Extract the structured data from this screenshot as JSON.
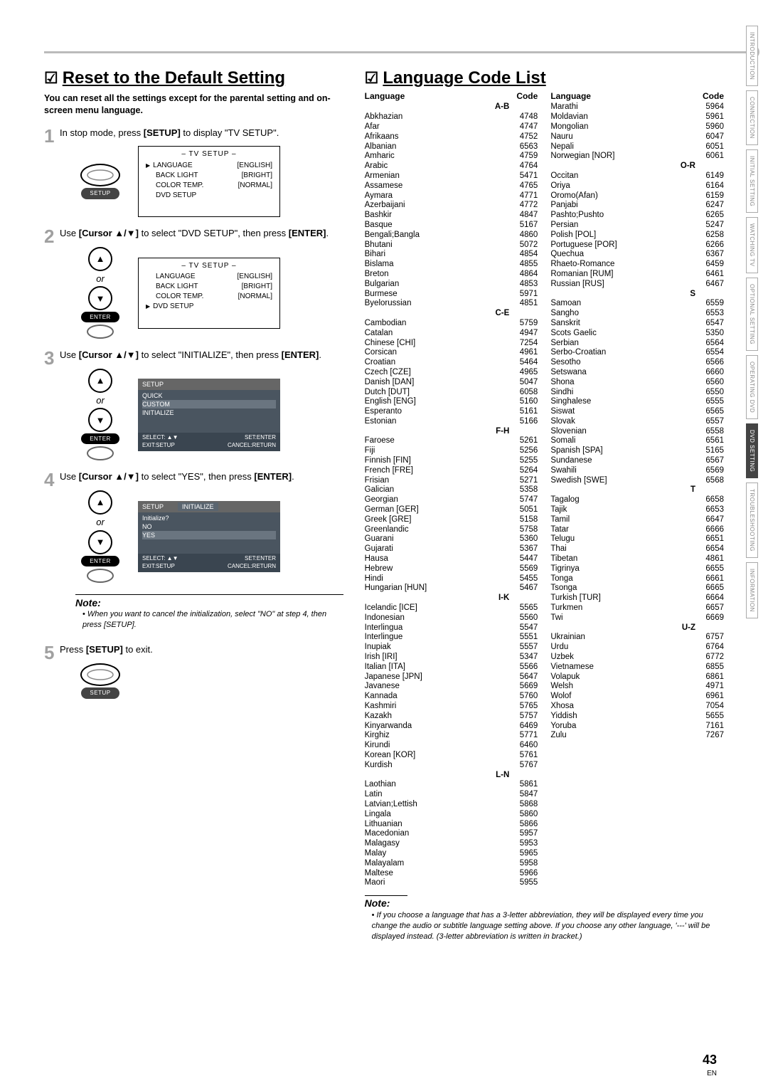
{
  "page_number": "43",
  "page_lang": "EN",
  "side_tabs": [
    "INTRODUCTION",
    "CONNECTION",
    "INITIAL SETTING",
    "WATCHING TV",
    "OPTIONAL SETTING",
    "OPERATING DVD",
    "DVD SETTING",
    "TROUBLESHOOTING",
    "INFORMATION"
  ],
  "left": {
    "title": "Reset to the Default Setting",
    "sub": "You can reset all the settings except for the parental setting and on-screen menu language.",
    "steps": [
      {
        "num": "1",
        "text_pre": "In stop mode, press ",
        "bold": "[SETUP]",
        "text_post": " to display \"TV SETUP\"."
      },
      {
        "num": "2",
        "text_pre": "Use ",
        "bold": "[Cursor ▲/▼]",
        "text_post": " to select \"DVD SETUP\", then press ",
        "bold2": "[ENTER]",
        "text_end": "."
      },
      {
        "num": "3",
        "text_pre": "Use ",
        "bold": "[Cursor ▲/▼]",
        "text_post": " to select \"INITIALIZE\", then press ",
        "bold2": "[ENTER]",
        "text_end": "."
      },
      {
        "num": "4",
        "text_pre": "Use ",
        "bold": "[Cursor ▲/▼]",
        "text_post": " to select \"YES\", then press ",
        "bold2": "[ENTER]",
        "text_end": "."
      },
      {
        "num": "5",
        "text_pre": "Press ",
        "bold": "[SETUP]",
        "text_post": " to exit."
      }
    ],
    "or": "or",
    "setup_label": "SETUP",
    "enter_label": "ENTER",
    "screen1": {
      "title": "– TV SETUP –",
      "rows": [
        [
          "LANGUAGE",
          "[ENGLISH]"
        ],
        [
          "BACK LIGHT",
          "[BRIGHT]"
        ],
        [
          "COLOR TEMP.",
          "[NORMAL]"
        ],
        [
          "DVD SETUP",
          ""
        ]
      ],
      "sel": 0
    },
    "screen2_rows": [
      [
        "LANGUAGE",
        "[ENGLISH]"
      ],
      [
        "BACK LIGHT",
        "[BRIGHT]"
      ],
      [
        "COLOR TEMP.",
        "[NORMAL]"
      ],
      [
        "DVD SETUP",
        ""
      ]
    ],
    "screen3": {
      "hd": "SETUP",
      "items": [
        "QUICK",
        "CUSTOM",
        "INITIALIZE"
      ],
      "ft_l": "SELECT: ▲▼",
      "ft_l2": "EXIT:SETUP",
      "ft_r": "SET:ENTER",
      "ft_r2": "CANCEL:RETURN"
    },
    "screen4": {
      "hd": "SETUP",
      "sub": "INITIALIZE",
      "q": "Initialize?",
      "items": [
        "NO",
        "YES"
      ]
    },
    "note_hd": "Note:",
    "note": "When you want to cancel the initialization, select \"NO\" at step 4, then press [SETUP]."
  },
  "right": {
    "title": "Language Code List",
    "col_hd_lang": "Language",
    "col_hd_code": "Code",
    "note_hd": "Note:",
    "note": "If you choose a language that has a 3-letter abbreviation, they will be displayed every time you change the audio or subtitle language setting above. If you choose any other language, '---' will be displayed instead. (3-letter abbreviation is written in bracket.)",
    "sections": {
      "A-B": [
        [
          "Abkhazian",
          "4748"
        ],
        [
          "Afar",
          "4747"
        ],
        [
          "Afrikaans",
          "4752"
        ],
        [
          "Albanian",
          "6563"
        ],
        [
          "Amharic",
          "4759"
        ],
        [
          "Arabic",
          "4764"
        ],
        [
          "Armenian",
          "5471"
        ],
        [
          "Assamese",
          "4765"
        ],
        [
          "Aymara",
          "4771"
        ],
        [
          "Azerbaijani",
          "4772"
        ],
        [
          "Bashkir",
          "4847"
        ],
        [
          "Basque",
          "5167"
        ],
        [
          "Bengali;Bangla",
          "4860"
        ],
        [
          "Bhutani",
          "5072"
        ],
        [
          "Bihari",
          "4854"
        ],
        [
          "Bislama",
          "4855"
        ],
        [
          "Breton",
          "4864"
        ],
        [
          "Bulgarian",
          "4853"
        ],
        [
          "Burmese",
          "5971"
        ],
        [
          "Byelorussian",
          "4851"
        ]
      ],
      "C-E": [
        [
          "Cambodian",
          "5759"
        ],
        [
          "Catalan",
          "4947"
        ],
        [
          "Chinese [CHI]",
          "7254"
        ],
        [
          "Corsican",
          "4961"
        ],
        [
          "Croatian",
          "5464"
        ],
        [
          "Czech [CZE]",
          "4965"
        ],
        [
          "Danish [DAN]",
          "5047"
        ],
        [
          "Dutch [DUT]",
          "6058"
        ],
        [
          "English [ENG]",
          "5160"
        ],
        [
          "Esperanto",
          "5161"
        ],
        [
          "Estonian",
          "5166"
        ]
      ],
      "F-H": [
        [
          "Faroese",
          "5261"
        ],
        [
          "Fiji",
          "5256"
        ],
        [
          "Finnish [FIN]",
          "5255"
        ],
        [
          "French [FRE]",
          "5264"
        ],
        [
          "Frisian",
          "5271"
        ],
        [
          "Galician",
          "5358"
        ],
        [
          "Georgian",
          "5747"
        ],
        [
          "German [GER]",
          "5051"
        ],
        [
          "Greek [GRE]",
          "5158"
        ],
        [
          "Greenlandic",
          "5758"
        ],
        [
          "Guarani",
          "5360"
        ],
        [
          "Gujarati",
          "5367"
        ],
        [
          "Hausa",
          "5447"
        ],
        [
          "Hebrew",
          "5569"
        ],
        [
          "Hindi",
          "5455"
        ],
        [
          "Hungarian [HUN]",
          "5467"
        ]
      ],
      "I-K": [
        [
          "Icelandic [ICE]",
          "5565"
        ],
        [
          "Indonesian",
          "5560"
        ],
        [
          "Interlingua",
          "5547"
        ],
        [
          "Interlingue",
          "5551"
        ],
        [
          "Inupiak",
          "5557"
        ],
        [
          "Irish [IRI]",
          "5347"
        ],
        [
          "Italian [ITA]",
          "5566"
        ],
        [
          "Japanese [JPN]",
          "5647"
        ],
        [
          "Javanese",
          "5669"
        ],
        [
          "Kannada",
          "5760"
        ],
        [
          "Kashmiri",
          "5765"
        ],
        [
          "Kazakh",
          "5757"
        ],
        [
          "Kinyarwanda",
          "6469"
        ],
        [
          "Kirghiz",
          "5771"
        ],
        [
          "Kirundi",
          "6460"
        ],
        [
          "Korean [KOR]",
          "5761"
        ],
        [
          "Kurdish",
          "5767"
        ]
      ],
      "L-N": [
        [
          "Laothian",
          "5861"
        ],
        [
          "Latin",
          "5847"
        ],
        [
          "Latvian;Lettish",
          "5868"
        ],
        [
          "Lingala",
          "5860"
        ],
        [
          "Lithuanian",
          "5866"
        ],
        [
          "Macedonian",
          "5957"
        ],
        [
          "Malagasy",
          "5953"
        ],
        [
          "Malay",
          "5965"
        ],
        [
          "Malayalam",
          "5958"
        ],
        [
          "Maltese",
          "5966"
        ],
        [
          "Maori",
          "5955"
        ],
        [
          "Marathi",
          "5964"
        ],
        [
          "Moldavian",
          "5961"
        ],
        [
          "Mongolian",
          "5960"
        ],
        [
          "Nauru",
          "6047"
        ],
        [
          "Nepali",
          "6051"
        ],
        [
          "Norwegian [NOR]",
          "6061"
        ]
      ],
      "O-R": [
        [
          "Occitan",
          "6149"
        ],
        [
          "Oriya",
          "6164"
        ],
        [
          "Oromo(Afan)",
          "6159"
        ],
        [
          "Panjabi",
          "6247"
        ],
        [
          "Pashto;Pushto",
          "6265"
        ],
        [
          "Persian",
          "5247"
        ],
        [
          "Polish [POL]",
          "6258"
        ],
        [
          "Portuguese [POR]",
          "6266"
        ],
        [
          "Quechua",
          "6367"
        ],
        [
          "Rhaeto-Romance",
          "6459"
        ],
        [
          "Romanian [RUM]",
          "6461"
        ],
        [
          "Russian [RUS]",
          "6467"
        ]
      ],
      "S": [
        [
          "Samoan",
          "6559"
        ],
        [
          "Sangho",
          "6553"
        ],
        [
          "Sanskrit",
          "6547"
        ],
        [
          "Scots Gaelic",
          "5350"
        ],
        [
          "Serbian",
          "6564"
        ],
        [
          "Serbo-Croatian",
          "6554"
        ],
        [
          "Sesotho",
          "6566"
        ],
        [
          "Setswana",
          "6660"
        ],
        [
          "Shona",
          "6560"
        ],
        [
          "Sindhi",
          "6550"
        ],
        [
          "Singhalese",
          "6555"
        ],
        [
          "Siswat",
          "6565"
        ],
        [
          "Slovak",
          "6557"
        ],
        [
          "Slovenian",
          "6558"
        ],
        [
          "Somali",
          "6561"
        ],
        [
          "Spanish [SPA]",
          "5165"
        ],
        [
          "Sundanese",
          "6567"
        ],
        [
          "Swahili",
          "6569"
        ],
        [
          "Swedish [SWE]",
          "6568"
        ]
      ],
      "T": [
        [
          "Tagalog",
          "6658"
        ],
        [
          "Tajik",
          "6653"
        ],
        [
          "Tamil",
          "6647"
        ],
        [
          "Tatar",
          "6666"
        ],
        [
          "Telugu",
          "6651"
        ],
        [
          "Thai",
          "6654"
        ],
        [
          "Tibetan",
          "4861"
        ],
        [
          "Tigrinya",
          "6655"
        ],
        [
          "Tonga",
          "6661"
        ],
        [
          "Tsonga",
          "6665"
        ],
        [
          "Turkish [TUR]",
          "6664"
        ],
        [
          "Turkmen",
          "6657"
        ],
        [
          "Twi",
          "6669"
        ]
      ],
      "U-Z": [
        [
          "Ukrainian",
          "6757"
        ],
        [
          "Urdu",
          "6764"
        ],
        [
          "Uzbek",
          "6772"
        ],
        [
          "Vietnamese",
          "6855"
        ],
        [
          "Volapuk",
          "6861"
        ],
        [
          "Welsh",
          "4971"
        ],
        [
          "Wolof",
          "6961"
        ],
        [
          "Xhosa",
          "7054"
        ],
        [
          "Yiddish",
          "5655"
        ],
        [
          "Yoruba",
          "7161"
        ],
        [
          "Zulu",
          "7267"
        ]
      ]
    },
    "col1_order": [
      "A-B",
      "C-E",
      "F-H",
      "I-K",
      "L-N"
    ],
    "col2_start_from": "Marathi",
    "col2_order": [
      "O-R",
      "S",
      "T",
      "U-Z"
    ]
  }
}
